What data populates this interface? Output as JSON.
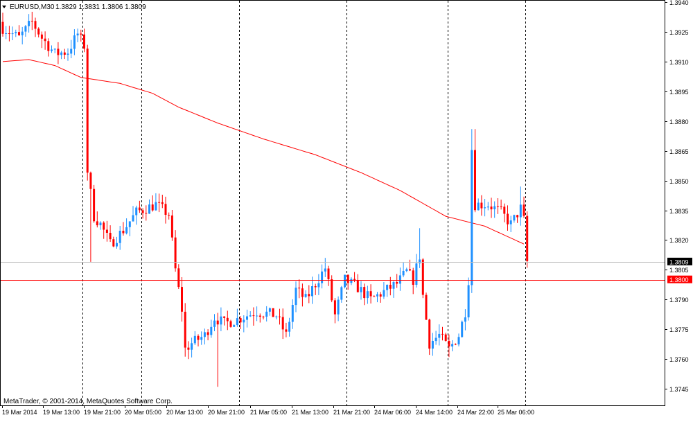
{
  "header": {
    "symbol": "EURUSD,M30",
    "ohlc": "1.3829 1.3831 1.3806 1.3809"
  },
  "footer": {
    "copyright": "MetaTrader, © 2001-2014, MetaQuotes Software Corp."
  },
  "colors": {
    "background": "#ffffff",
    "bull": "#1e90ff",
    "bear": "#ff0000",
    "ma": "#ff0000",
    "grid": "#000000",
    "bid_line": "#c0c0c0",
    "level_line": "#ff0000",
    "price_tag_bg": "#000000",
    "level_tag_bg": "#ff0000",
    "axis_text": "#000000"
  },
  "chart_data": {
    "type": "candlestick",
    "title": "EURUSD,M30",
    "grid": "vertical-dashed",
    "ylim": [
      1.3737,
      1.394
    ],
    "y_ticks": [
      "1.3940",
      "1.3925",
      "1.3910",
      "1.3895",
      "1.3880",
      "1.3865",
      "1.3850",
      "1.3835",
      "1.3820",
      "1.3805",
      "1.3790",
      "1.3775",
      "1.3760",
      "1.3745"
    ],
    "x_ticks": [
      "19 Mar 2014",
      "19 Mar 13:00",
      "19 Mar 21:00",
      "20 Mar 05:00",
      "20 Mar 13:00",
      "20 Mar 21:00",
      "21 Mar 05:00",
      "21 Mar 13:00",
      "21 Mar 21:00",
      "24 Mar 06:00",
      "24 Mar 14:00",
      "24 Mar 22:00",
      "25 Mar 06:00"
    ],
    "day_separators_after_bar_index": [
      24,
      42,
      72,
      105,
      136,
      160
    ],
    "current_price": {
      "label": "1.3809",
      "value": 1.3809
    },
    "level_line": {
      "label": "1.3800",
      "value": 1.38
    },
    "moving_average_anchors": [
      [
        0,
        1.391
      ],
      [
        8,
        1.3911
      ],
      [
        16,
        1.3908
      ],
      [
        24,
        1.3902
      ],
      [
        36,
        1.3899
      ],
      [
        46,
        1.3894
      ],
      [
        54,
        1.3887
      ],
      [
        66,
        1.3879
      ],
      [
        80,
        1.3871
      ],
      [
        96,
        1.3863
      ],
      [
        110,
        1.3854
      ],
      [
        122,
        1.3845
      ],
      [
        136,
        1.3832
      ],
      [
        148,
        1.3827
      ],
      [
        156,
        1.3821
      ],
      [
        160,
        1.3818
      ]
    ],
    "price_anchors": [
      [
        0,
        1.3927
      ],
      [
        5,
        1.3922
      ],
      [
        9,
        1.393
      ],
      [
        12,
        1.3922
      ],
      [
        16,
        1.3914
      ],
      [
        20,
        1.3915
      ],
      [
        23,
        1.3924
      ],
      [
        25,
        1.3918
      ],
      [
        26,
        1.3855
      ],
      [
        28,
        1.3832
      ],
      [
        30,
        1.3828
      ],
      [
        33,
        1.3818
      ],
      [
        37,
        1.3825
      ],
      [
        41,
        1.3834
      ],
      [
        47,
        1.3838
      ],
      [
        51,
        1.3833
      ],
      [
        53,
        1.3805
      ],
      [
        55,
        1.3785
      ],
      [
        56,
        1.3765
      ],
      [
        58,
        1.3768
      ],
      [
        62,
        1.3772
      ],
      [
        65,
        1.3781
      ],
      [
        68,
        1.3778
      ],
      [
        72,
        1.378
      ],
      [
        78,
        1.3784
      ],
      [
        84,
        1.3782
      ],
      [
        87,
        1.3772
      ],
      [
        90,
        1.3795
      ],
      [
        93,
        1.379
      ],
      [
        96,
        1.3798
      ],
      [
        99,
        1.3806
      ],
      [
        102,
        1.3782
      ],
      [
        105,
        1.38
      ],
      [
        109,
        1.3796
      ],
      [
        113,
        1.379
      ],
      [
        117,
        1.3794
      ],
      [
        121,
        1.3798
      ],
      [
        124,
        1.3804
      ],
      [
        126,
        1.38
      ],
      [
        128,
        1.3812
      ],
      [
        129,
        1.3792
      ],
      [
        131,
        1.3768
      ],
      [
        134,
        1.3772
      ],
      [
        137,
        1.3765
      ],
      [
        140,
        1.3772
      ],
      [
        142,
        1.3784
      ],
      [
        143,
        1.38
      ],
      [
        144,
        1.3866
      ],
      [
        145,
        1.3838
      ],
      [
        149,
        1.3838
      ],
      [
        153,
        1.3834
      ],
      [
        156,
        1.3828
      ],
      [
        159,
        1.3836
      ],
      [
        160,
        1.383
      ],
      [
        161,
        1.3809
      ]
    ],
    "spikes": [
      {
        "bar": 27,
        "low": 1.3809
      },
      {
        "bar": 57,
        "low": 1.376
      },
      {
        "bar": 66,
        "low": 1.3746
      },
      {
        "bar": 99,
        "high": 1.3811
      },
      {
        "bar": 128,
        "high": 1.3826
      },
      {
        "bar": 137,
        "low": 1.3761
      },
      {
        "bar": 144,
        "high": 1.3876
      },
      {
        "bar": 145,
        "high": 1.3876
      },
      {
        "bar": 159,
        "high": 1.3847
      },
      {
        "bar": 161,
        "low": 1.3806
      }
    ]
  }
}
